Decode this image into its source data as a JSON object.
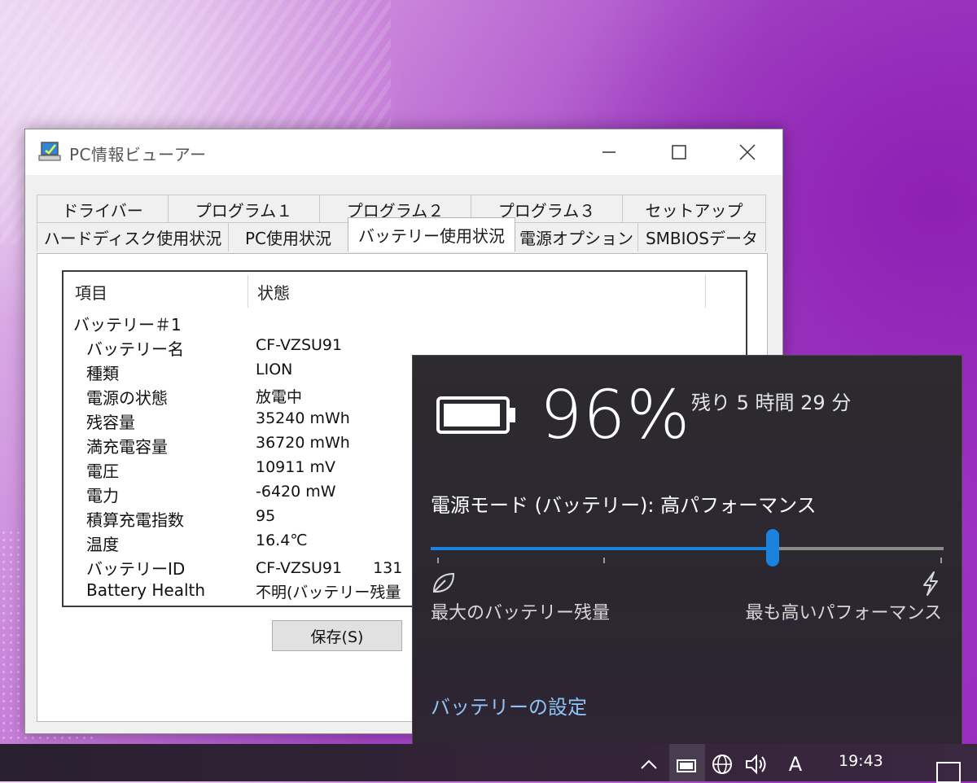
{
  "window": {
    "title": "PC情報ビューアー",
    "icon": "pc-monitor-icon"
  },
  "tabs": {
    "row1": [
      "ドライバー",
      "プログラム１",
      "プログラム２",
      "プログラム３",
      "セットアップ"
    ],
    "row2": [
      "ハードディスク使用状況",
      "PC使用状況",
      "バッテリー使用状況",
      "電源オプション",
      "SMBIOSデータ"
    ],
    "selected": "バッテリー使用状況"
  },
  "list": {
    "columns": [
      "項目",
      "状態"
    ],
    "group": "バッテリー＃1",
    "rows": [
      {
        "item": "バッテリー名",
        "value": "CF-VZSU91"
      },
      {
        "item": "種類",
        "value": "LION"
      },
      {
        "item": "電源の状態",
        "value": "放電中"
      },
      {
        "item": "残容量",
        "value": "35240 mWh"
      },
      {
        "item": "満充電容量",
        "value": "36720 mWh"
      },
      {
        "item": "電圧",
        "value": "10911 mV"
      },
      {
        "item": "電力",
        "value": "-6420 mW"
      },
      {
        "item": "積算充電指数",
        "value": "95"
      },
      {
        "item": "温度",
        "value": "16.4℃"
      },
      {
        "item": "バッテリーID",
        "value": "CF-VZSU91　　131"
      },
      {
        "item": "Battery Health",
        "value": "不明(バッテリー残量"
      }
    ]
  },
  "save_button": "保存(S)",
  "flyout": {
    "percent": "96%",
    "level": 0.96,
    "remaining": "残り 5 時間 29 分",
    "mode_label": "電源モード (バッテリー): 高パフォーマンス",
    "slider_position": 0.667,
    "left_label": "最大のバッテリー残量",
    "right_label": "最も高いパフォーマンス",
    "settings_link": "バッテリーの設定",
    "accent": "#1a83e0"
  },
  "taskbar": {
    "clock": "19:43",
    "ime": "A",
    "icons": [
      "chevron-up-icon",
      "battery-icon",
      "globe-icon",
      "volume-icon",
      "ime-icon",
      "notification-icon"
    ]
  }
}
